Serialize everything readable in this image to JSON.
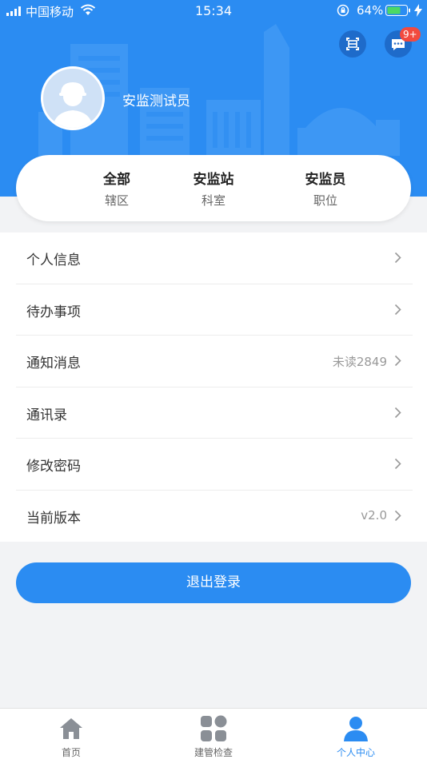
{
  "status_bar": {
    "carrier": "中国移动",
    "time": "15:34",
    "battery": "64%"
  },
  "header": {
    "username": "安监测试员",
    "badge": "9+"
  },
  "info_card": [
    {
      "value": "全部",
      "label": "辖区"
    },
    {
      "value": "安监站",
      "label": "科室"
    },
    {
      "value": "安监员",
      "label": "职位"
    }
  ],
  "menu": [
    {
      "label": "个人信息",
      "value": ""
    },
    {
      "label": "待办事项",
      "value": ""
    },
    {
      "label": "通知消息",
      "value": "未读2849"
    },
    {
      "label": "通讯录",
      "value": ""
    },
    {
      "label": "修改密码",
      "value": ""
    },
    {
      "label": "当前版本",
      "value": "v2.0"
    }
  ],
  "logout_label": "退出登录",
  "tabs": [
    {
      "label": "首页",
      "icon": "home-icon"
    },
    {
      "label": "建管检查",
      "icon": "grid-icon"
    },
    {
      "label": "个人中心",
      "icon": "user-icon"
    }
  ],
  "colors": {
    "primary": "#2b8cf2",
    "badge": "#f24a3e",
    "background": "#f2f3f5"
  }
}
